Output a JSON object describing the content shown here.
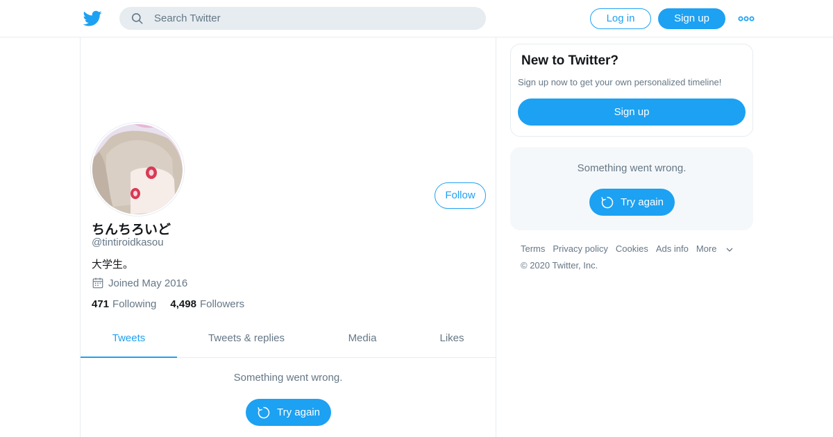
{
  "header": {
    "logo_icon": "twitter-bird-icon",
    "search_placeholder": "Search Twitter",
    "login_label": "Log in",
    "signup_label": "Sign up",
    "more_icon": "more-dots-icon"
  },
  "profile": {
    "display_name": "ちんちろいど",
    "handle": "@tintiroidkasou",
    "bio": "大学生。",
    "joined": "Joined May 2016",
    "follow_label": "Follow",
    "following_count": "471",
    "following_label": "Following",
    "followers_count": "4,498",
    "followers_label": "Followers"
  },
  "tabs": [
    "Tweets",
    "Tweets & replies",
    "Media",
    "Likes"
  ],
  "timeline": {
    "error_message": "Something went wrong.",
    "retry_label": "Try again"
  },
  "sidebar": {
    "new_title": "New to Twitter?",
    "new_desc": "Sign up now to get your own personalized timeline!",
    "new_signup_label": "Sign up",
    "error_message": "Something went wrong.",
    "retry_label": "Try again"
  },
  "footer": {
    "links": [
      "Terms",
      "Privacy policy",
      "Cookies",
      "Ads info",
      "More"
    ],
    "copyright": "© 2020 Twitter, Inc."
  },
  "colors": {
    "accent": "#1da1f2",
    "text_secondary": "#657786",
    "border": "#e6ecf0"
  }
}
